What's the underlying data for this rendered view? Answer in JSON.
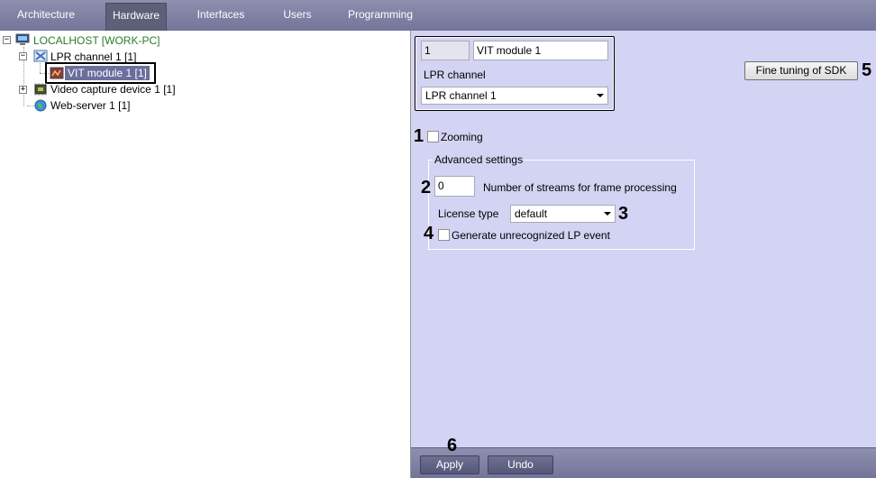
{
  "tabs": [
    {
      "label": "Architecture",
      "active": false
    },
    {
      "label": "Hardware",
      "active": true
    },
    {
      "label": "Interfaces",
      "active": false
    },
    {
      "label": "Users",
      "active": false
    },
    {
      "label": "Programming",
      "active": false
    }
  ],
  "tree": {
    "root": {
      "label": "LOCALHOST [WORK-PC]",
      "expander": "−",
      "icon": "computer-icon",
      "color": "#2b7a2b"
    },
    "lpr_channel": {
      "label": "LPR channel 1 [1]",
      "expander": "−",
      "icon": "lpr-channel-icon"
    },
    "vit_module": {
      "label": "VIT module 1 [1]",
      "icon": "vit-module-icon"
    },
    "video_capture": {
      "label": "Video capture device 1 [1]",
      "expander": "+",
      "icon": "capture-board-icon"
    },
    "web_server": {
      "label": "Web-server 1 [1]",
      "icon": "globe-icon"
    }
  },
  "header": {
    "id_value": "1",
    "name_value": "VIT module 1",
    "parent_label": "LPR channel",
    "parent_selected": "LPR channel  1"
  },
  "settings": {
    "zooming_label": "Zooming",
    "zooming_checked": false,
    "advanced_title": "Advanced settings",
    "streams_value": "0",
    "streams_label": "Number of streams for frame processing",
    "license_label": "License type",
    "license_value": "default",
    "generate_label": "Generate unrecognized LP event",
    "generate_checked": false,
    "sdk_button": "Fine tuning of SDK"
  },
  "callouts": {
    "n1": "1",
    "n2": "2",
    "n3": "3",
    "n4": "4",
    "n5": "5",
    "n6": "6"
  },
  "footer": {
    "apply_label": "Apply",
    "undo_label": "Undo"
  }
}
